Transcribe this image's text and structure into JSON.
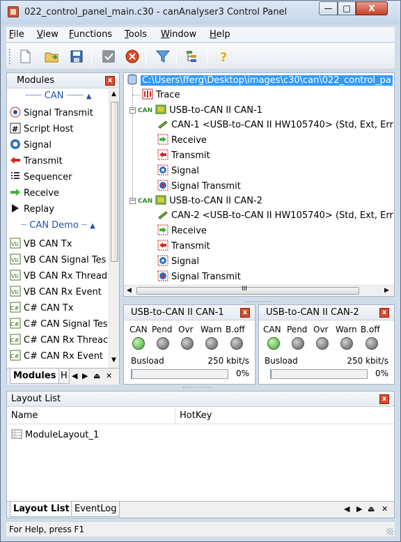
{
  "window": {
    "title": "022_control_panel_main.c30 - canAnalyser3 Control Panel",
    "min_label": "—",
    "max_label": "□",
    "close_label": "X"
  },
  "menu": [
    {
      "label": "File",
      "key": "F",
      "rest": "ile"
    },
    {
      "label": "View",
      "key": "V",
      "rest": "iew"
    },
    {
      "label": "Functions",
      "key": "F",
      "rest": "unctions"
    },
    {
      "label": "Tools",
      "key": "T",
      "rest": "ools"
    },
    {
      "label": "Window",
      "key": "W",
      "rest": "indow"
    },
    {
      "label": "Help",
      "key": "H",
      "rest": "elp"
    }
  ],
  "toolbar": {
    "icons": [
      "new-file-icon",
      "open-folder-icon",
      "save-icon",
      "checkmark-icon",
      "stop-icon",
      "filter-icon",
      "tree-icon",
      "help-icon"
    ]
  },
  "modules": {
    "title": "Modules",
    "groups": [
      {
        "name": "CAN",
        "items": [
          {
            "label": "Signal Transmit",
            "icon": "signal-transmit-icon"
          },
          {
            "label": "Script Host",
            "icon": "script-host-icon"
          },
          {
            "label": "Signal",
            "icon": "signal-icon"
          },
          {
            "label": "Transmit",
            "icon": "transmit-icon"
          },
          {
            "label": "Sequencer",
            "icon": "sequencer-icon"
          },
          {
            "label": "Receive",
            "icon": "receive-icon"
          },
          {
            "label": "Replay",
            "icon": "replay-icon"
          }
        ]
      },
      {
        "name": "CAN Demo",
        "items": [
          {
            "label": "VB CAN Tx",
            "icon": "vb-icon"
          },
          {
            "label": "VB CAN Signal Tes",
            "icon": "vb-icon"
          },
          {
            "label": "VB CAN Rx Thread",
            "icon": "vb-icon"
          },
          {
            "label": "VB CAN Rx Event",
            "icon": "vb-icon"
          },
          {
            "label": "C# CAN Tx",
            "icon": "csharp-icon"
          },
          {
            "label": "C# CAN Signal Tes",
            "icon": "csharp-icon"
          },
          {
            "label": "C# CAN Rx Threac",
            "icon": "csharp-icon"
          },
          {
            "label": "C# CAN Rx Event",
            "icon": "csharp-icon"
          }
        ]
      }
    ],
    "tabs": [
      "Modules",
      "H"
    ]
  },
  "tree": {
    "root": "C:\\Users\\fferg\\Desktop\\images\\c30\\can\\022_control_pa",
    "trace": "Trace",
    "devices": [
      {
        "tag": "CAN",
        "name": "USB-to-CAN II  CAN-1",
        "channel": "CAN-1  <USB-to-CAN II HW105740>  (Std, Ext, Err",
        "children": [
          "Receive",
          "Transmit",
          "Signal",
          "Signal Transmit"
        ]
      },
      {
        "tag": "CAN",
        "name": "USB-to-CAN II  CAN-2",
        "channel": "CAN-2  <USB-to-CAN II HW105740>  (Std, Ext, Err",
        "children": [
          "Receive",
          "Transmit",
          "Signal",
          "Signal Transmit"
        ]
      }
    ],
    "scroll_label": "III"
  },
  "status_panels": [
    {
      "title": "USB-to-CAN II  CAN-1",
      "leds": [
        "CAN",
        "Pend",
        "Ovr",
        "Warn",
        "B.off"
      ],
      "led_states": [
        "green",
        "gray",
        "gray",
        "gray",
        "gray"
      ],
      "busload_label": "Busload",
      "rate": "250 kbit/s",
      "percent": "0%",
      "busload_value": 0
    },
    {
      "title": "USB-to-CAN II  CAN-2",
      "leds": [
        "CAN",
        "Pend",
        "Ovr",
        "Warn",
        "B.off"
      ],
      "led_states": [
        "green",
        "gray",
        "gray",
        "gray",
        "gray"
      ],
      "busload_label": "Busload",
      "rate": "250 kbit/s",
      "percent": "0%",
      "busload_value": 0
    }
  ],
  "layout_list": {
    "title": "Layout List",
    "columns": [
      "Name",
      "HotKey"
    ],
    "rows": [
      {
        "name": "ModuleLayout_1",
        "hotkey": ""
      }
    ],
    "tabs": [
      "Layout List",
      "EventLog"
    ]
  },
  "statusbar": {
    "text": "For Help, press F1"
  },
  "colors": {
    "accent": "#3399ff",
    "close": "#d84a2b",
    "led_on": "#3aa12a"
  }
}
